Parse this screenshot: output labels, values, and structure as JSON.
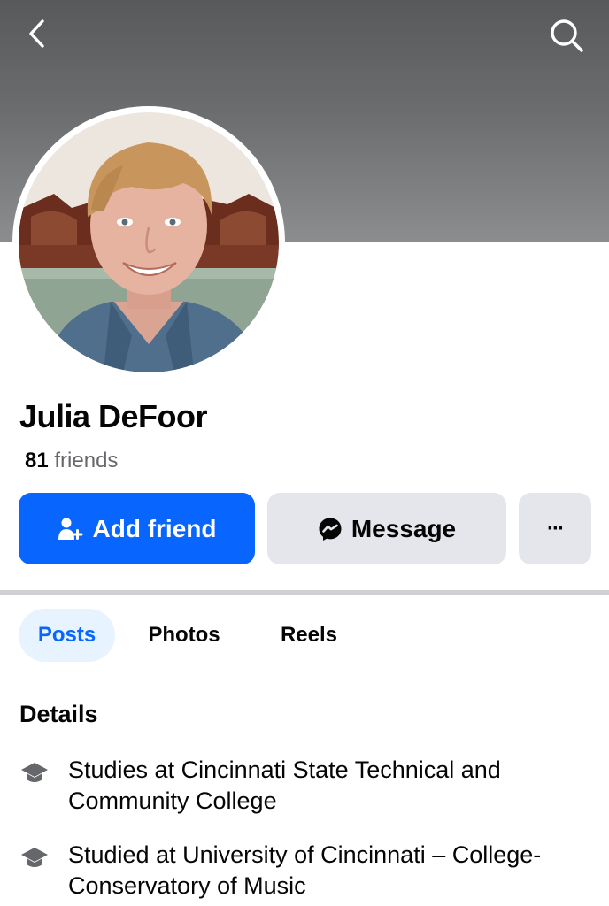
{
  "header": {
    "back_icon": "chevron-left-icon",
    "search_icon": "search-icon"
  },
  "profile": {
    "name": "Julia DeFoor",
    "friends_count": "81",
    "friends_label": "friends"
  },
  "actions": {
    "add_friend_label": "Add friend",
    "message_label": "Message",
    "more_label": "···"
  },
  "tabs": [
    {
      "label": "Posts",
      "active": true
    },
    {
      "label": "Photos",
      "active": false
    },
    {
      "label": "Reels",
      "active": false
    }
  ],
  "details": {
    "title": "Details",
    "items": [
      {
        "icon": "graduation-cap-icon",
        "text": "Studies at Cincinnati State Technical and Community College"
      },
      {
        "icon": "graduation-cap-icon",
        "text": "Studied at University of Cincinnati – College-Conservatory of Music"
      }
    ]
  },
  "colors": {
    "accent": "#0866ff",
    "secondary_button": "#e4e6eb",
    "active_tab_bg": "#e7f3ff",
    "muted_text": "#65676b"
  }
}
